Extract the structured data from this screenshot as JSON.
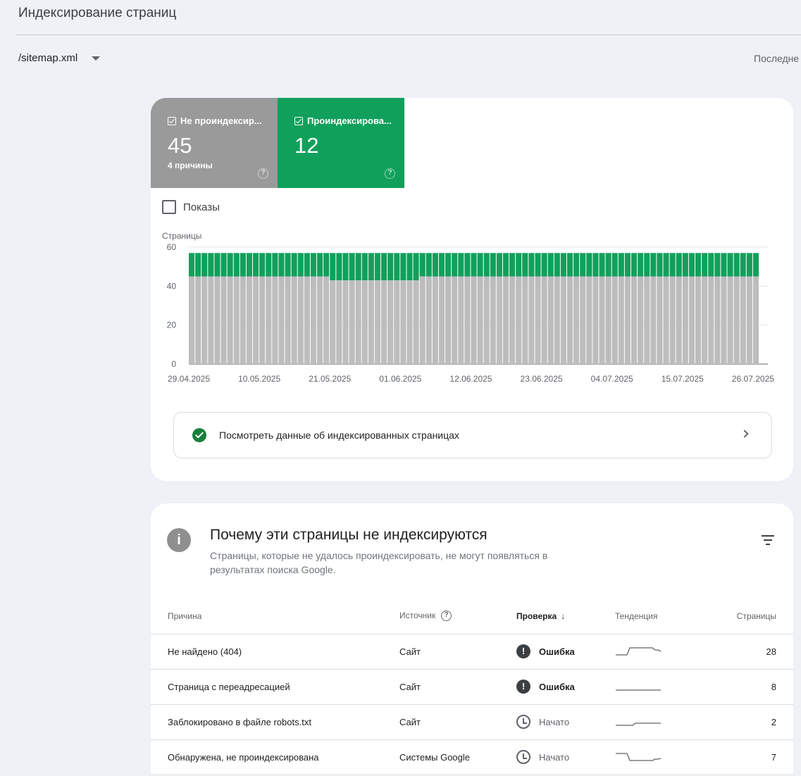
{
  "page": {
    "title": "Индексирование страниц",
    "sitemap_value": "/sitemap.xml",
    "last_updated_prefix": "Последне"
  },
  "tiles": {
    "not_indexed": {
      "label": "Не проиндексир...",
      "count": "45",
      "sub": "4 причины",
      "color": "#9a9a9a"
    },
    "indexed": {
      "label": "Проиндексирова...",
      "count": "12",
      "color": "#10a05b"
    }
  },
  "impressions_label": "Показы",
  "chart_data": {
    "type": "bar",
    "stacked": true,
    "ylabel": "Страницы",
    "ylim": [
      0,
      60
    ],
    "yticks": [
      0,
      20,
      40,
      60
    ],
    "x_tick_labels": [
      "29.04.2025",
      "10.05.2025",
      "21.05.2025",
      "01.06.2025",
      "12.06.2025",
      "23.06.2025",
      "04.07.2025",
      "15.07.2025",
      "26.07.2025"
    ],
    "x_start": "29.04.2025",
    "x_end": "26.07.2025",
    "series": [
      {
        "color": "#bdbdbd",
        "segments": [
          {
            "from": "29.04.2025",
            "to": "20.05.2025",
            "value": 45
          },
          {
            "from": "21.05.2025",
            "to": "03.06.2025",
            "value": 43
          },
          {
            "from": "04.06.2025",
            "to": "26.07.2025",
            "value": 45
          }
        ]
      },
      {
        "color": "#10a05b",
        "segments": [
          {
            "from": "29.04.2025",
            "to": "20.05.2025",
            "value": 12
          },
          {
            "from": "21.05.2025",
            "to": "03.06.2025",
            "value": 14
          },
          {
            "from": "04.06.2025",
            "to": "26.07.2025",
            "value": 12
          }
        ]
      }
    ],
    "grid": true
  },
  "view_indexed_label": "Посмотреть данные об индексированных страницах",
  "why": {
    "title": "Почему эти страницы не индексируются",
    "description": "Страницы, которые не удалось проиндексировать, не могут появляться в результатах поиска Google."
  },
  "table": {
    "headers": {
      "reason": "Причина",
      "source": "Источник",
      "check": "Проверка",
      "trend": "Тенденция",
      "pages": "Страницы"
    },
    "rows": [
      {
        "reason": "Не найдено (404)",
        "source": "Сайт",
        "status": "Ошибка",
        "status_type": "error",
        "pages": "28",
        "trend": [
          0,
          0,
          0,
          0,
          0,
          1,
          1,
          1,
          1,
          1,
          1,
          1,
          1,
          1,
          0.7,
          0.7,
          0.5
        ]
      },
      {
        "reason": "Страница с переадресацией",
        "source": "Сайт",
        "status": "Ошибка",
        "status_type": "error",
        "pages": "8",
        "trend": [
          0,
          0,
          0,
          0,
          0,
          0,
          0,
          0,
          0,
          0,
          0,
          0,
          0,
          0,
          0,
          0,
          0
        ]
      },
      {
        "reason": "Заблокировано в файле robots.txt",
        "source": "Сайт",
        "status": "Начато",
        "status_type": "started",
        "pages": "2",
        "trend": [
          0,
          0,
          0,
          0,
          0,
          0,
          0,
          0.3,
          0.3,
          0.3,
          0.3,
          0.3,
          0.3,
          0.3,
          0.3,
          0.3,
          0.3
        ]
      },
      {
        "reason": "Обнаружена, не проиндексирована",
        "source": "Системы Google",
        "status": "Начато",
        "status_type": "started",
        "pages": "7",
        "trend": [
          1,
          1,
          1,
          1,
          1,
          0,
          0,
          0,
          0,
          0,
          0,
          0,
          0,
          0,
          0.2,
          0.2,
          0.3
        ]
      }
    ]
  }
}
